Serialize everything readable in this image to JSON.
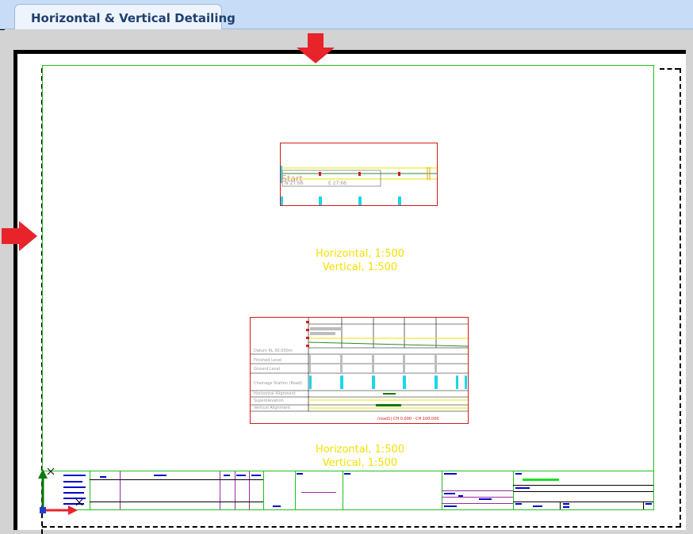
{
  "tabs": [
    {
      "label": "Horizontal & Vertical Detailing",
      "active": true
    }
  ],
  "plan_view": {
    "label_horizontal": "Horizontal, 1:500",
    "label_vertical": "Vertical, 1:500",
    "start_label": "Start",
    "text_left": "N 27:66",
    "text_right": "E 27:66"
  },
  "profile_view": {
    "label_horizontal": "Horizontal, 1:500",
    "label_vertical": "Vertical, 1:500",
    "datum": "Datum RL 00.000m",
    "row_labels": [
      "Finished Level",
      "Ground Level",
      "Chainage Station (Road)",
      "Horizontal Alignment",
      "Superelevation",
      "Vertical Alignment"
    ],
    "range_text": "(road1) CH 0.000 - CH 100.000"
  },
  "colors": {
    "accent_red": "#e8232a",
    "frame_green": "#1ec21e",
    "label_yellow": "#f5e000",
    "view_border": "#d21a1a",
    "tab_bar": "#c7dcf7"
  }
}
